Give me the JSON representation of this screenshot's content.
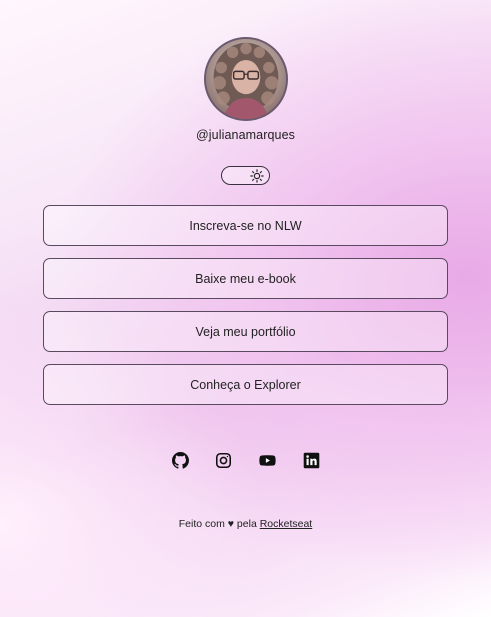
{
  "profile": {
    "username": "@julianamarques",
    "avatar_alt": "avatar"
  },
  "theme_toggle": {
    "icon": "sun-icon"
  },
  "links": [
    {
      "label": "Inscreva-se no NLW"
    },
    {
      "label": "Baixe meu e-book"
    },
    {
      "label": "Veja meu portfólio"
    },
    {
      "label": "Conheça o Explorer"
    }
  ],
  "social": [
    {
      "icon": "github-icon"
    },
    {
      "icon": "instagram-icon"
    },
    {
      "icon": "youtube-icon"
    },
    {
      "icon": "linkedin-icon"
    }
  ],
  "footer": {
    "prefix": "Feito com ♥ pela ",
    "link_label": "Rocketseat"
  },
  "colors": {
    "accent": "#efc8ee",
    "border": "#5a4a60",
    "text": "#222222"
  }
}
